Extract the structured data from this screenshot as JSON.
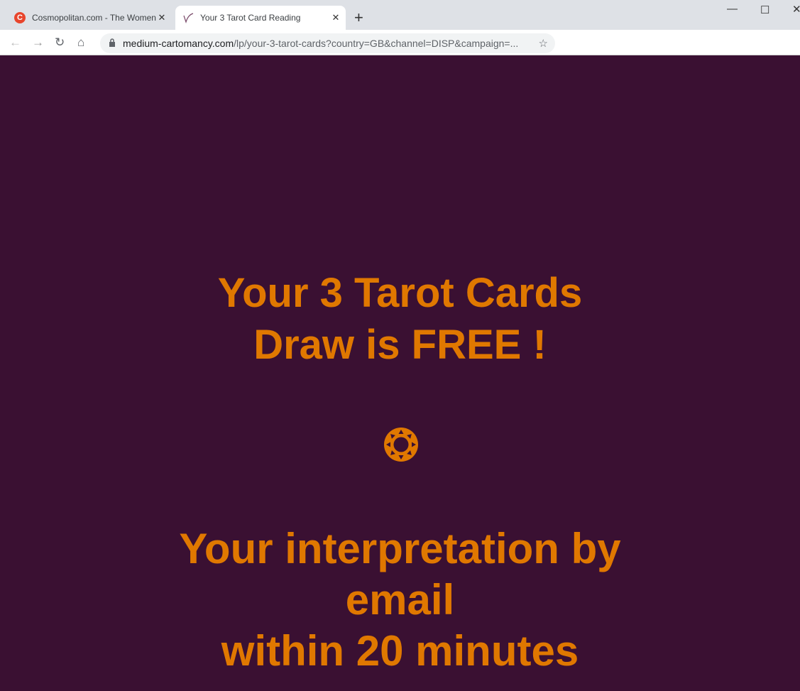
{
  "browser": {
    "tabs": [
      {
        "title": "Cosmopolitan.com - The Women's",
        "icon": "cosmopolitan-c-icon"
      },
      {
        "title": "Your 3 Tarot Card Reading",
        "icon": "tarot-swoosh-icon",
        "active": true
      }
    ],
    "url_host": "medium-cartomancy.com",
    "url_path": "/lp/your-3-tarot-cards?country=GB&channel=DISP&campaign=..."
  },
  "page": {
    "headline_line1": "Your 3 Tarot Cards",
    "headline_line2": "Draw is FREE !",
    "sub_line1": "Your interpretation by",
    "sub_line2": "email",
    "sub_line3": "within 20 minutes",
    "icon": "sun-icon"
  },
  "colors": {
    "background": "#3a1032",
    "accent": "#e07800"
  }
}
